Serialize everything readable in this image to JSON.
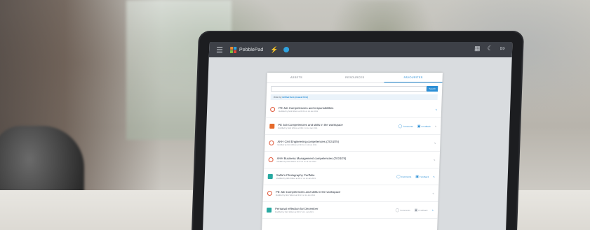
{
  "app": {
    "brand": "PebblePad"
  },
  "icons": {
    "menu": "hamburger-icon",
    "bolt": "lightning-icon",
    "globe": "globe-icon",
    "grid": "grid-icon",
    "moon": "moon-icon",
    "logout": "logout-icon"
  },
  "tabs": [
    {
      "label": "ASSETS"
    },
    {
      "label": "RESOURCES"
    },
    {
      "label": "FAVOURITES"
    }
  ],
  "search": {
    "button": "Search"
  },
  "filter": {
    "prefix": "Order by",
    "value": "Unfiled item (newest first)"
  },
  "rows": [
    {
      "title": "PE Job Competencies and responsibilities",
      "sub": "Modified by Nick Wilson at 09:01 on 14 Jan 2021",
      "tag": ""
    },
    {
      "title": "PE Job Competencies and skills in the workspace",
      "sub": "Modified by Nick Wilson at 08:17 on 14 Jan 2021",
      "tag": "",
      "a1": "Comments",
      "a2": "Feedback"
    },
    {
      "title": "AHH Civil Engineering competencies (2024/25)",
      "sub": "Modified by Nick Wilson at 08:15 on 14 Jan 2021",
      "tag": ""
    },
    {
      "title": "AHH Business Management competencies (2024/25)",
      "sub": "Modified by Nick Wilson at 07:55 on 14 Jan 2021",
      "tag": ""
    },
    {
      "title": "Sallie's Photography Portfolio",
      "sub": "Modified by Nick Wilson at 08:17 on 14 Jan 2021",
      "tag": "",
      "a1": "Comments",
      "a2": "Feedback"
    },
    {
      "title": "PE Job Competencies and skills in the workspace",
      "sub": "Modified by Nick Wilson at 08:17 on 14 Jan 2021",
      "tag": ""
    },
    {
      "title": "Personal reflection for December",
      "sub": "Modified by Nick Wilson at 08:07 on 1 Jan 2021",
      "tag": "",
      "a1": "Comments",
      "a2": "Feedback"
    }
  ],
  "colors": {
    "accent": "#2b8fd6",
    "topbar": "#3d4047"
  }
}
